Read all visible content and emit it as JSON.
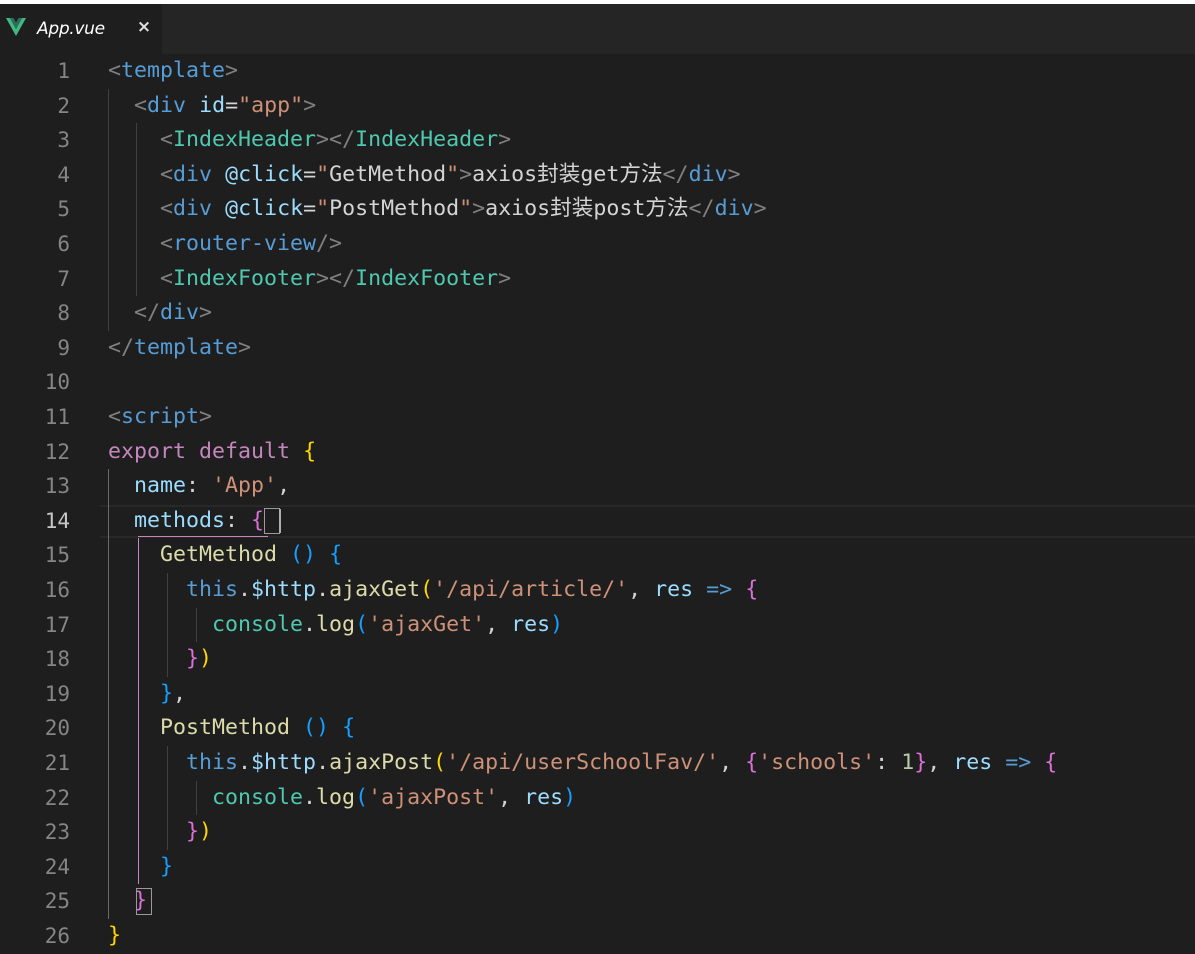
{
  "tab": {
    "title": "App.vue",
    "icon": "vue-icon",
    "close_glyph": "×"
  },
  "colors": {
    "background": "#1e1e1e",
    "tag": "#569cd6",
    "attribute": "#9cdcfe",
    "string": "#ce9178",
    "keyword": "#c586c0",
    "function": "#dcdcaa",
    "class": "#4ec9b0",
    "number": "#b5cea8",
    "bracket_level_1": "#ffd700",
    "bracket_level_2": "#da70d6",
    "bracket_level_3": "#179fff"
  },
  "editor": {
    "active_line": 14,
    "lines": [
      {
        "n": "1",
        "tokens": [
          [
            "t",
            "<"
          ],
          [
            "tn",
            "template"
          ],
          [
            "t",
            ">"
          ]
        ]
      },
      {
        "n": "2",
        "tokens": [
          [
            "w",
            "  "
          ],
          [
            "t",
            "<"
          ],
          [
            "tn",
            "div"
          ],
          [
            "cm",
            " "
          ],
          [
            "at",
            "id"
          ],
          [
            "cm",
            "="
          ],
          [
            "s",
            "\"app\""
          ],
          [
            "t",
            ">"
          ]
        ]
      },
      {
        "n": "3",
        "tokens": [
          [
            "w",
            "    "
          ],
          [
            "t",
            "<"
          ],
          [
            "cls",
            "IndexHeader"
          ],
          [
            "t",
            "></"
          ],
          [
            "cls",
            "IndexHeader"
          ],
          [
            "t",
            ">"
          ]
        ]
      },
      {
        "n": "4",
        "tokens": [
          [
            "w",
            "    "
          ],
          [
            "t",
            "<"
          ],
          [
            "tn",
            "div"
          ],
          [
            "cm",
            " "
          ],
          [
            "at",
            "@click"
          ],
          [
            "cm",
            "="
          ],
          [
            "s",
            "\""
          ],
          [
            "cm",
            "GetMethod"
          ],
          [
            "s",
            "\""
          ],
          [
            "t",
            ">"
          ],
          [
            "cm",
            "axios封装get方法"
          ],
          [
            "t",
            "</"
          ],
          [
            "tn",
            "div"
          ],
          [
            "t",
            ">"
          ]
        ]
      },
      {
        "n": "5",
        "tokens": [
          [
            "w",
            "    "
          ],
          [
            "t",
            "<"
          ],
          [
            "tn",
            "div"
          ],
          [
            "cm",
            " "
          ],
          [
            "at",
            "@click"
          ],
          [
            "cm",
            "="
          ],
          [
            "s",
            "\""
          ],
          [
            "cm",
            "PostMethod"
          ],
          [
            "s",
            "\""
          ],
          [
            "t",
            ">"
          ],
          [
            "cm",
            "axios封装post方法"
          ],
          [
            "t",
            "</"
          ],
          [
            "tn",
            "div"
          ],
          [
            "t",
            ">"
          ]
        ]
      },
      {
        "n": "6",
        "tokens": [
          [
            "w",
            "    "
          ],
          [
            "t",
            "<"
          ],
          [
            "tn",
            "router-view"
          ],
          [
            "t",
            "/>"
          ]
        ]
      },
      {
        "n": "7",
        "tokens": [
          [
            "w",
            "    "
          ],
          [
            "t",
            "<"
          ],
          [
            "cls",
            "IndexFooter"
          ],
          [
            "t",
            "></"
          ],
          [
            "cls",
            "IndexFooter"
          ],
          [
            "t",
            ">"
          ]
        ]
      },
      {
        "n": "8",
        "tokens": [
          [
            "w",
            "  "
          ],
          [
            "t",
            "</"
          ],
          [
            "tn",
            "div"
          ],
          [
            "t",
            ">"
          ]
        ]
      },
      {
        "n": "9",
        "tokens": [
          [
            "t",
            "</"
          ],
          [
            "tn",
            "template"
          ],
          [
            "t",
            ">"
          ]
        ]
      },
      {
        "n": "10",
        "tokens": []
      },
      {
        "n": "11",
        "tokens": [
          [
            "t",
            "<"
          ],
          [
            "tn",
            "script"
          ],
          [
            "t",
            ">"
          ]
        ]
      },
      {
        "n": "12",
        "tokens": [
          [
            "kw",
            "export"
          ],
          [
            "cm",
            " "
          ],
          [
            "kw",
            "default"
          ],
          [
            "cm",
            " "
          ],
          [
            "b1",
            "{"
          ]
        ]
      },
      {
        "n": "13",
        "tokens": [
          [
            "w",
            "  "
          ],
          [
            "pr",
            "name"
          ],
          [
            "cm",
            ": "
          ],
          [
            "s",
            "'App'"
          ],
          [
            "cm",
            ","
          ]
        ]
      },
      {
        "n": "14",
        "tokens": [
          [
            "w",
            "  "
          ],
          [
            "pr",
            "methods"
          ],
          [
            "cm",
            ": "
          ],
          [
            "b2",
            "{"
          ]
        ]
      },
      {
        "n": "15",
        "tokens": [
          [
            "w",
            "    "
          ],
          [
            "fn",
            "GetMethod"
          ],
          [
            "cm",
            " "
          ],
          [
            "b3",
            "()"
          ],
          [
            "cm",
            " "
          ],
          [
            "b3",
            "{"
          ]
        ]
      },
      {
        "n": "16",
        "tokens": [
          [
            "w",
            "      "
          ],
          [
            "tn",
            "this"
          ],
          [
            "cm",
            "."
          ],
          [
            "pr",
            "$http"
          ],
          [
            "cm",
            "."
          ],
          [
            "fn",
            "ajaxGet"
          ],
          [
            "b1",
            "("
          ],
          [
            "s",
            "'/api/article/'"
          ],
          [
            "cm",
            ", "
          ],
          [
            "pr",
            "res"
          ],
          [
            "cm",
            " "
          ],
          [
            "tn",
            "=>"
          ],
          [
            "cm",
            " "
          ],
          [
            "b2",
            "{"
          ]
        ]
      },
      {
        "n": "17",
        "tokens": [
          [
            "w",
            "        "
          ],
          [
            "cls",
            "console"
          ],
          [
            "cm",
            "."
          ],
          [
            "fn",
            "log"
          ],
          [
            "b3",
            "("
          ],
          [
            "s",
            "'ajaxGet'"
          ],
          [
            "cm",
            ", "
          ],
          [
            "pr",
            "res"
          ],
          [
            "b3",
            ")"
          ]
        ]
      },
      {
        "n": "18",
        "tokens": [
          [
            "w",
            "      "
          ],
          [
            "b2",
            "}"
          ],
          [
            "b1",
            ")"
          ]
        ]
      },
      {
        "n": "19",
        "tokens": [
          [
            "w",
            "    "
          ],
          [
            "b3",
            "}"
          ],
          [
            "cm",
            ","
          ]
        ]
      },
      {
        "n": "20",
        "tokens": [
          [
            "w",
            "    "
          ],
          [
            "fn",
            "PostMethod"
          ],
          [
            "cm",
            " "
          ],
          [
            "b3",
            "()"
          ],
          [
            "cm",
            " "
          ],
          [
            "b3",
            "{"
          ]
        ]
      },
      {
        "n": "21",
        "tokens": [
          [
            "w",
            "      "
          ],
          [
            "tn",
            "this"
          ],
          [
            "cm",
            "."
          ],
          [
            "pr",
            "$http"
          ],
          [
            "cm",
            "."
          ],
          [
            "fn",
            "ajaxPost"
          ],
          [
            "b1",
            "("
          ],
          [
            "s",
            "'/api/userSchoolFav/'"
          ],
          [
            "cm",
            ", "
          ],
          [
            "b2",
            "{"
          ],
          [
            "s",
            "'schools'"
          ],
          [
            "cm",
            ": "
          ],
          [
            "num",
            "1"
          ],
          [
            "b2",
            "}"
          ],
          [
            "cm",
            ", "
          ],
          [
            "pr",
            "res"
          ],
          [
            "cm",
            " "
          ],
          [
            "tn",
            "=>"
          ],
          [
            "cm",
            " "
          ],
          [
            "b2",
            "{"
          ]
        ]
      },
      {
        "n": "22",
        "tokens": [
          [
            "w",
            "        "
          ],
          [
            "cls",
            "console"
          ],
          [
            "cm",
            "."
          ],
          [
            "fn",
            "log"
          ],
          [
            "b3",
            "("
          ],
          [
            "s",
            "'ajaxPost'"
          ],
          [
            "cm",
            ", "
          ],
          [
            "pr",
            "res"
          ],
          [
            "b3",
            ")"
          ]
        ]
      },
      {
        "n": "23",
        "tokens": [
          [
            "w",
            "      "
          ],
          [
            "b2",
            "}"
          ],
          [
            "b1",
            ")"
          ]
        ]
      },
      {
        "n": "24",
        "tokens": [
          [
            "w",
            "    "
          ],
          [
            "b3",
            "}"
          ]
        ]
      },
      {
        "n": "25",
        "tokens": [
          [
            "w",
            "  "
          ],
          [
            "b2",
            "}"
          ]
        ]
      },
      {
        "n": "26",
        "tokens": [
          [
            "b1",
            "}"
          ]
        ]
      }
    ]
  }
}
